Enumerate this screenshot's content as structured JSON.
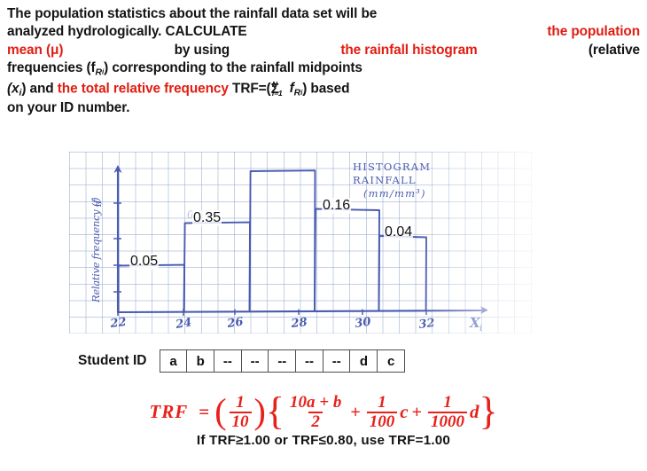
{
  "statement": {
    "line1_black": "The population statistics about the rainfall data set will be",
    "line2_black_a": "analyzed  hydrologically.  CALCULATE",
    "line2_red": "the  population",
    "line3_red_a": "mean (μ)",
    "line3_black_a": "by  using",
    "line3_red_b": "the  rainfall  histogram",
    "line3_black_b": "(relative",
    "line4_black_a": "frequencies (f",
    "line4_sub_R": "R",
    "line4_sub_i": "i",
    "line4_black_b": ") corresponding to the rainfall midpoints",
    "line5_black_a": "(x",
    "line5_sub_i": "i",
    "line5_black_b": ") and",
    "line5_red": "the  total  relative  frequency",
    "line5_black_c": "TRF=(",
    "line5_sigma": "Σ",
    "line5_sigma_sup": "N",
    "line5_sigma_sub": "i=1",
    "line5_black_d": "f",
    "line5_black_e": ") based",
    "line6_black": "on your ID number."
  },
  "chart_data": {
    "type": "bar",
    "title": "HISTOGRAM RAINFALL (mm/mm³)",
    "title_lines": [
      "HISTOGRAM",
      "RAINFALL",
      "(mm/mm³)"
    ],
    "xlabel": "Xi",
    "ylabel": "Relative frequency (fR)",
    "grid": true,
    "legend": "none",
    "ylim": [
      0,
      0.5
    ],
    "categories": [
      "22",
      "24",
      "26",
      "28",
      "30",
      "32"
    ],
    "tick_labels": [
      "22",
      "24",
      "26",
      "28",
      "30",
      "32"
    ],
    "bar_labels": [
      "0.05",
      "0.35",
      "",
      "0.16",
      "0.04"
    ],
    "values": [
      0.05,
      0.35,
      0.45,
      0.16,
      0.04
    ],
    "faint_pencil_values": [
      "",
      "0.35",
      "",
      "",
      ""
    ]
  },
  "student_id": {
    "label": "Student ID",
    "cells": [
      "a",
      "b",
      "--",
      "--",
      "--",
      "--",
      "--",
      "d",
      "c"
    ]
  },
  "formula": {
    "trf": "TRF",
    "equals": "=",
    "outer_num": "1",
    "outer_den": "10",
    "t1_num": "10a + b",
    "t1_den": "2",
    "plus1": "+",
    "t2_num": "1",
    "t2_den": "100",
    "t2_var": "c",
    "plus2": "+",
    "t3_num": "1",
    "t3_den": "1000",
    "t3_var": "d",
    "note": "If  TRF≥1.00 or TRF≤0.80, use TRF=1.00"
  },
  "colors": {
    "red": "#e8201a",
    "ink": "#4a5bb0",
    "grid": "#96aacd",
    "text": "#141414"
  }
}
